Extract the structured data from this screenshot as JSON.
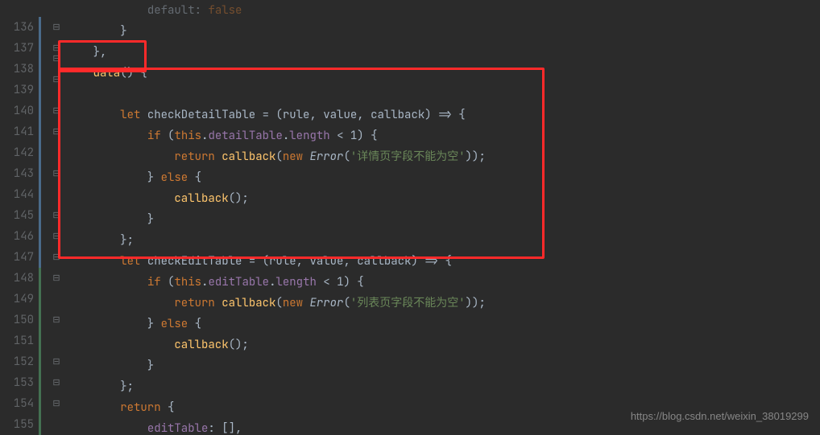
{
  "watermark": "https://blog.csdn.net/weixin_38019299",
  "lines": [
    {
      "num": "",
      "vbar": null,
      "marks": "",
      "tokens": [
        {
          "t": "            ",
          "c": "punc dim"
        },
        {
          "t": "default",
          "c": "id dim"
        },
        {
          "t": ": ",
          "c": "punc dim"
        },
        {
          "t": "false",
          "c": "kw dim"
        }
      ]
    },
    {
      "num": "136",
      "vbar": "blue",
      "marks": "⊟",
      "tokens": [
        {
          "t": "        }",
          "c": "punc"
        }
      ]
    },
    {
      "num": "137",
      "vbar": "blue",
      "marks": "⊟",
      "tokens": [
        {
          "t": "    },",
          "c": "punc"
        }
      ]
    },
    {
      "num": "138",
      "vbar": "blue",
      "marks": "⊟ ⊟",
      "tokens": [
        {
          "t": "    ",
          "c": "punc"
        },
        {
          "t": "data",
          "c": "fn"
        },
        {
          "t": "() {",
          "c": "punc"
        }
      ]
    },
    {
      "num": "139",
      "vbar": "blue",
      "marks": "",
      "tokens": [
        {
          "t": " ",
          "c": "punc"
        }
      ]
    },
    {
      "num": "140",
      "vbar": "blue",
      "marks": "⊟",
      "tokens": [
        {
          "t": "        ",
          "c": "punc"
        },
        {
          "t": "let",
          "c": "kw"
        },
        {
          "t": " ",
          "c": "punc"
        },
        {
          "t": "checkDetailTable",
          "c": "id"
        },
        {
          "t": " = (",
          "c": "punc"
        },
        {
          "t": "rule",
          "c": "id"
        },
        {
          "t": ", ",
          "c": "punc"
        },
        {
          "t": "value",
          "c": "id"
        },
        {
          "t": ", ",
          "c": "punc"
        },
        {
          "t": "callback",
          "c": "id"
        },
        {
          "t": ") => {",
          "c": "punc"
        }
      ]
    },
    {
      "num": "141",
      "vbar": "blue",
      "marks": "⊟",
      "tokens": [
        {
          "t": "            ",
          "c": "punc"
        },
        {
          "t": "if",
          "c": "kw"
        },
        {
          "t": " (",
          "c": "punc"
        },
        {
          "t": "this",
          "c": "kw"
        },
        {
          "t": ".",
          "c": "punc"
        },
        {
          "t": "detailTable",
          "c": "prop"
        },
        {
          "t": ".",
          "c": "punc"
        },
        {
          "t": "length",
          "c": "prop"
        },
        {
          "t": " < ",
          "c": "op"
        },
        {
          "t": "1",
          "c": "id"
        },
        {
          "t": ") {",
          "c": "punc"
        }
      ]
    },
    {
      "num": "142",
      "vbar": "blue",
      "marks": "",
      "tokens": [
        {
          "t": "                ",
          "c": "punc"
        },
        {
          "t": "return",
          "c": "kw"
        },
        {
          "t": " ",
          "c": "punc"
        },
        {
          "t": "callback",
          "c": "fn"
        },
        {
          "t": "(",
          "c": "punc"
        },
        {
          "t": "new",
          "c": "kw"
        },
        {
          "t": " ",
          "c": "punc"
        },
        {
          "t": "Error",
          "c": "cls"
        },
        {
          "t": "(",
          "c": "punc"
        },
        {
          "t": "'详情页字段不能为空'",
          "c": "str"
        },
        {
          "t": "));",
          "c": "punc"
        }
      ]
    },
    {
      "num": "143",
      "vbar": "blue",
      "marks": "⊟",
      "tokens": [
        {
          "t": "            } ",
          "c": "punc"
        },
        {
          "t": "else",
          "c": "kw"
        },
        {
          "t": " {",
          "c": "punc"
        }
      ]
    },
    {
      "num": "144",
      "vbar": "blue",
      "marks": "",
      "tokens": [
        {
          "t": "                ",
          "c": "punc"
        },
        {
          "t": "callback",
          "c": "fn"
        },
        {
          "t": "();",
          "c": "punc"
        }
      ]
    },
    {
      "num": "145",
      "vbar": "blue",
      "marks": "⊟",
      "tokens": [
        {
          "t": "            }",
          "c": "punc"
        }
      ]
    },
    {
      "num": "146",
      "vbar": "blue",
      "marks": "⊟",
      "tokens": [
        {
          "t": "        };",
          "c": "punc"
        }
      ]
    },
    {
      "num": "147",
      "vbar": "blue",
      "marks": "⊟",
      "tokens": [
        {
          "t": "        ",
          "c": "punc"
        },
        {
          "t": "let",
          "c": "kw"
        },
        {
          "t": " ",
          "c": "punc"
        },
        {
          "t": "checkEditTable",
          "c": "id"
        },
        {
          "t": " = (",
          "c": "punc"
        },
        {
          "t": "rule",
          "c": "id"
        },
        {
          "t": ", ",
          "c": "punc"
        },
        {
          "t": "value",
          "c": "id"
        },
        {
          "t": ", ",
          "c": "punc"
        },
        {
          "t": "callback",
          "c": "id"
        },
        {
          "t": ") => {",
          "c": "punc"
        }
      ]
    },
    {
      "num": "148",
      "vbar": "green",
      "marks": "⊟",
      "tokens": [
        {
          "t": "            ",
          "c": "punc"
        },
        {
          "t": "if",
          "c": "kw"
        },
        {
          "t": " (",
          "c": "punc"
        },
        {
          "t": "this",
          "c": "kw"
        },
        {
          "t": ".",
          "c": "punc"
        },
        {
          "t": "editTable",
          "c": "prop"
        },
        {
          "t": ".",
          "c": "punc"
        },
        {
          "t": "length",
          "c": "prop"
        },
        {
          "t": " < ",
          "c": "op"
        },
        {
          "t": "1",
          "c": "id"
        },
        {
          "t": ") {",
          "c": "punc"
        }
      ]
    },
    {
      "num": "149",
      "vbar": "green",
      "marks": "",
      "tokens": [
        {
          "t": "                ",
          "c": "punc"
        },
        {
          "t": "return",
          "c": "kw"
        },
        {
          "t": " ",
          "c": "punc"
        },
        {
          "t": "callback",
          "c": "fn"
        },
        {
          "t": "(",
          "c": "punc"
        },
        {
          "t": "new",
          "c": "kw"
        },
        {
          "t": " ",
          "c": "punc"
        },
        {
          "t": "Error",
          "c": "cls"
        },
        {
          "t": "(",
          "c": "punc"
        },
        {
          "t": "'列表页字段不能为空'",
          "c": "str"
        },
        {
          "t": "));",
          "c": "punc"
        }
      ]
    },
    {
      "num": "150",
      "vbar": "green",
      "marks": "⊟",
      "tokens": [
        {
          "t": "            } ",
          "c": "punc"
        },
        {
          "t": "else",
          "c": "kw"
        },
        {
          "t": " {",
          "c": "punc"
        }
      ]
    },
    {
      "num": "151",
      "vbar": "green",
      "marks": "",
      "tokens": [
        {
          "t": "                ",
          "c": "punc"
        },
        {
          "t": "callback",
          "c": "fn"
        },
        {
          "t": "();",
          "c": "punc"
        }
      ]
    },
    {
      "num": "152",
      "vbar": "green",
      "marks": "⊟",
      "tokens": [
        {
          "t": "            }",
          "c": "punc"
        }
      ]
    },
    {
      "num": "153",
      "vbar": "green",
      "marks": "⊟",
      "tokens": [
        {
          "t": "        };",
          "c": "punc"
        }
      ]
    },
    {
      "num": "154",
      "vbar": "green",
      "marks": "⊟",
      "tokens": [
        {
          "t": "        ",
          "c": "punc"
        },
        {
          "t": "return",
          "c": "kw"
        },
        {
          "t": " {",
          "c": "punc"
        }
      ]
    },
    {
      "num": "155",
      "vbar": "green",
      "marks": "",
      "tokens": [
        {
          "t": "            ",
          "c": "punc"
        },
        {
          "t": "editTable",
          "c": "prop"
        },
        {
          "t": ": [],",
          "c": "punc"
        }
      ]
    }
  ]
}
